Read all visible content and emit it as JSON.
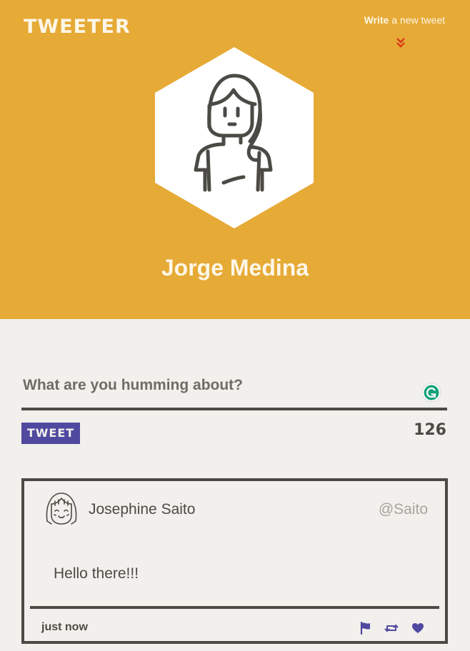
{
  "header": {
    "brand": "TWEETER",
    "write_bold": "Write",
    "write_rest": " a new tweet",
    "profile_name": "Jorge Medina"
  },
  "compose": {
    "placeholder": "What are you humming about?",
    "button_label": "TWEET",
    "char_count": "126"
  },
  "tweet": {
    "author_name": "Josephine Saito",
    "handle": "@Saito",
    "body": "Hello there!!!",
    "timestamp": "just now",
    "actions": [
      "flag-icon",
      "retweet-icon",
      "heart-icon"
    ]
  },
  "colors": {
    "header_bg": "#e6aa36",
    "page_bg": "#f1f0ec",
    "accent": "#5049a0",
    "text_dark": "#4b4a45",
    "chevron": "#d93b1b"
  }
}
